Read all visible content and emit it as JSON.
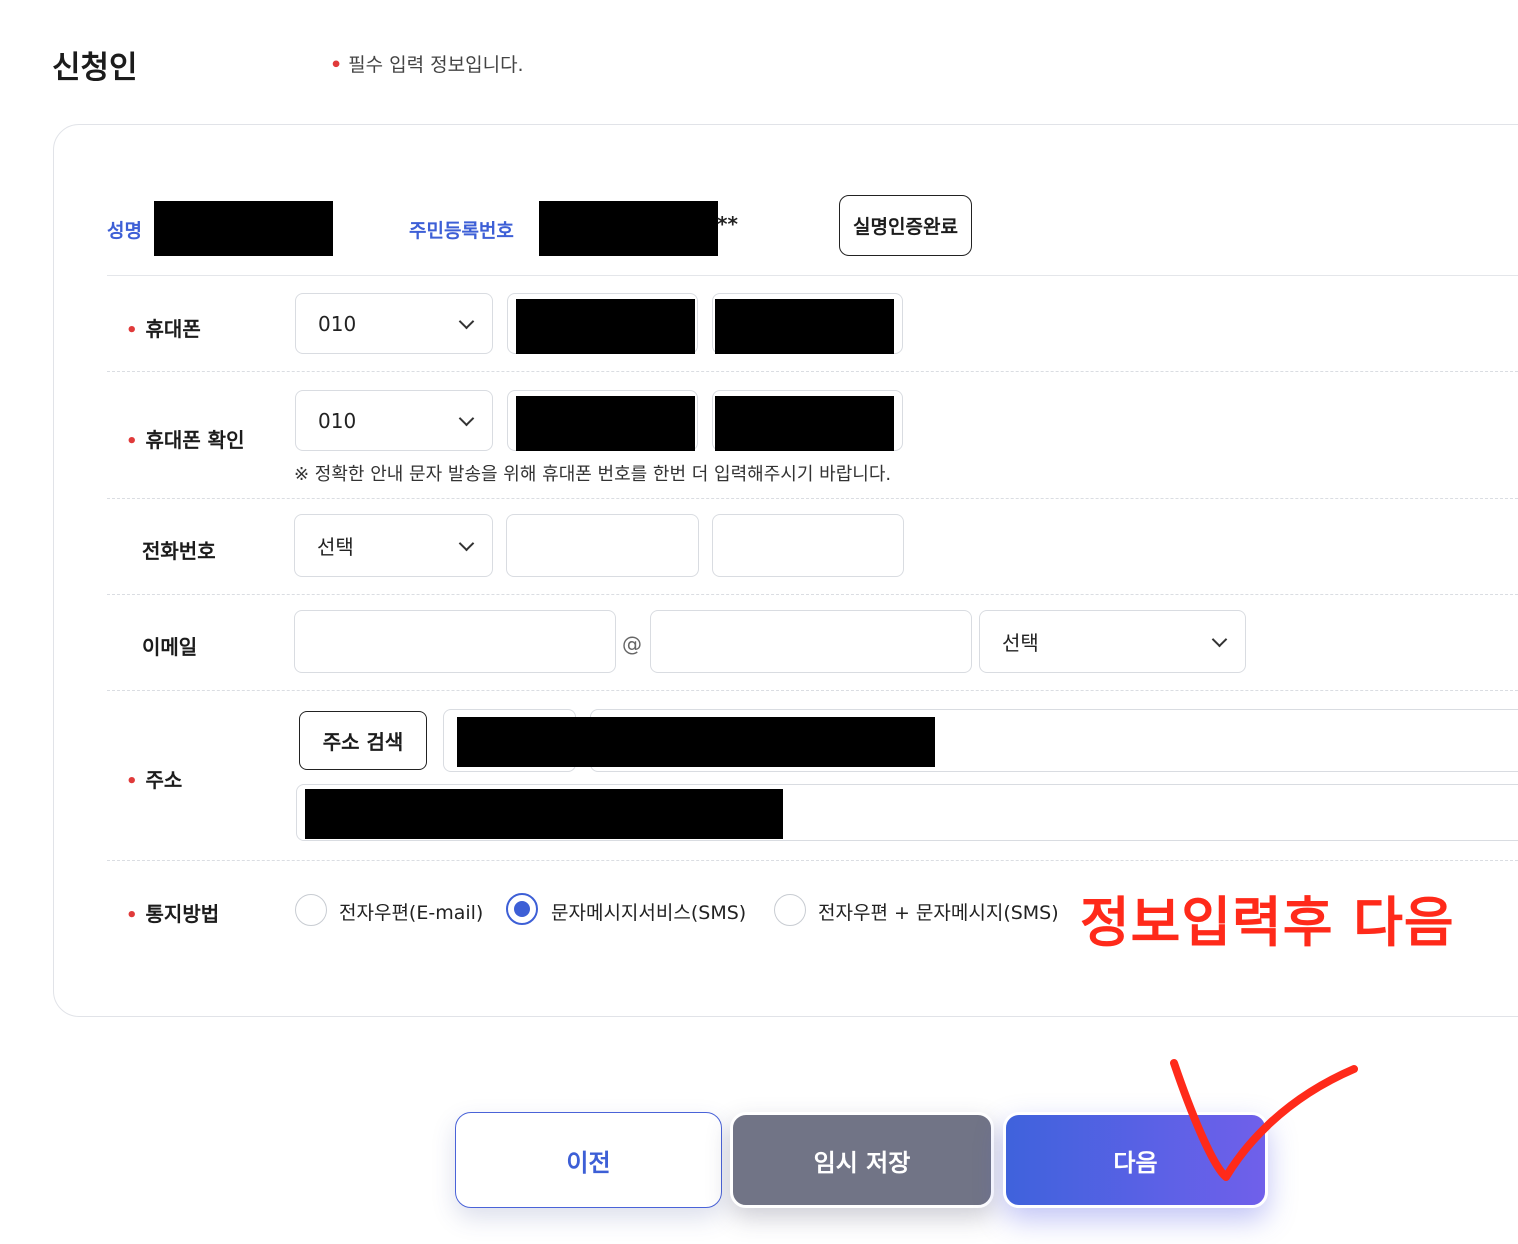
{
  "header": {
    "title": "신청인",
    "required_note": "필수 입력 정보입니다."
  },
  "identity": {
    "name_label": "성명",
    "rrn_label": "주민등록번호",
    "rrn_suffix": "**",
    "verify_button": "실명인증완료"
  },
  "phone": {
    "label": "휴대폰",
    "prefix": "010"
  },
  "phone_confirm": {
    "label": "휴대폰 확인",
    "prefix": "010",
    "hint": "※ 정확한 안내 문자 발송을 위해 휴대폰 번호를 한번 더 입력해주시기 바랍니다."
  },
  "telephone": {
    "label": "전화번호",
    "prefix": "선택",
    "middle_value": "",
    "last_value": ""
  },
  "email": {
    "label": "이메일",
    "local_value": "",
    "at": "@",
    "domain_value": "",
    "domain_select": "선택"
  },
  "address": {
    "label": "주소",
    "search_button": "주소 검색"
  },
  "notify": {
    "label": "통지방법",
    "options": [
      {
        "label": "전자우편(E-mail)",
        "selected": false
      },
      {
        "label": "문자메시지서비스(SMS)",
        "selected": true
      },
      {
        "label": "전자우편 + 문자메시지(SMS)",
        "selected": false
      }
    ]
  },
  "annotation": {
    "text": "정보입력후 다음",
    "color": "#ff2a1a"
  },
  "buttons": {
    "prev": "이전",
    "save": "임시 저장",
    "next": "다음"
  },
  "colors": {
    "accent": "#3d5fd6",
    "required_dot": "#e03a3a",
    "save_button": "#717486"
  }
}
